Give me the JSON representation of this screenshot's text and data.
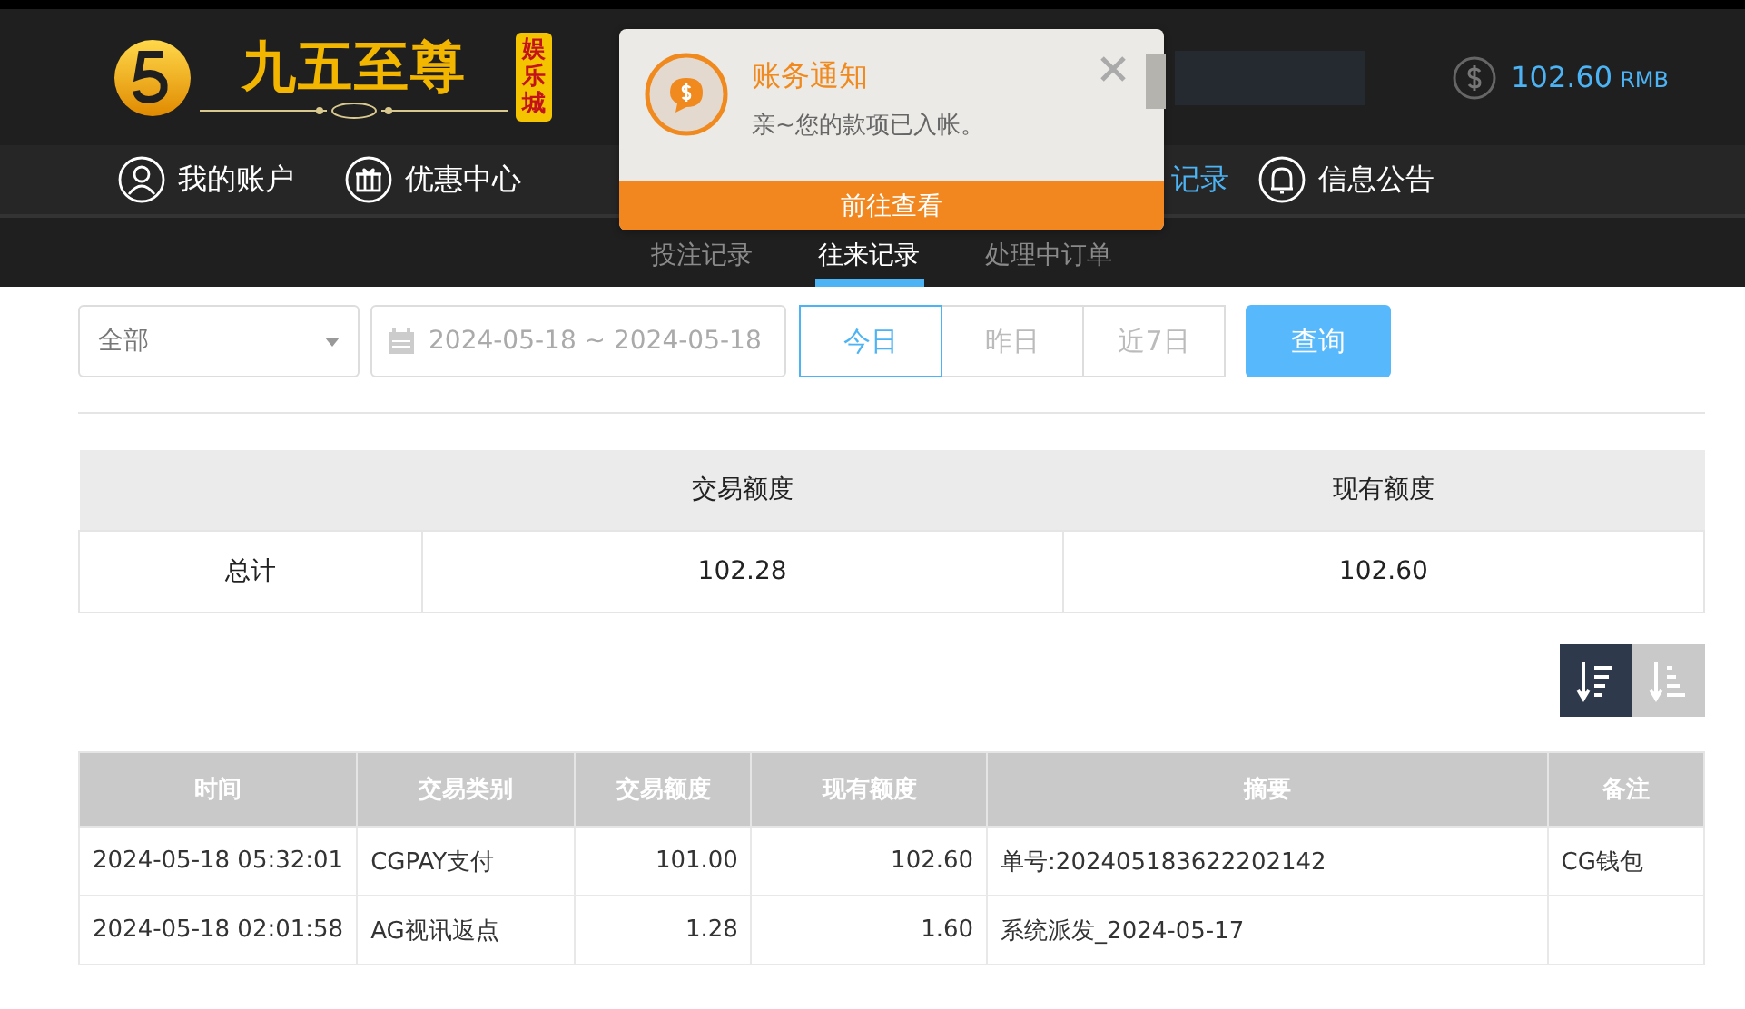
{
  "header": {
    "logo_text": "九五至尊",
    "logo_badge": "娱乐城",
    "balance": "102.60",
    "currency": "RMB"
  },
  "nav": [
    {
      "kind": "link",
      "label": "我的账户",
      "selected": false
    },
    {
      "kind": "link",
      "label": "优惠中心",
      "selected": false
    },
    {
      "kind": "covered"
    },
    {
      "kind": "covered"
    },
    {
      "kind": "partial",
      "label": "记录",
      "selected": true
    },
    {
      "kind": "link",
      "label": "信息公告",
      "selected": false
    }
  ],
  "subtabs": [
    {
      "label": "投注记录",
      "selected": false
    },
    {
      "label": "往来记录",
      "selected": true
    },
    {
      "label": "处理中订单",
      "selected": false
    }
  ],
  "filter": {
    "type_select": "全部",
    "date_range": "2024-05-18 ~ 2024-05-18",
    "search_button": "查询",
    "quick_ranges": [
      {
        "label": "今日",
        "selected": true
      },
      {
        "label": "昨日",
        "selected": false
      },
      {
        "label": "近7日",
        "selected": false
      }
    ]
  },
  "summary": {
    "columns": [
      "交易额度",
      "现有额度"
    ],
    "rows": [
      {
        "label": "总计",
        "values": [
          "102.28",
          "102.60"
        ]
      }
    ]
  },
  "sort_buttons": [
    {
      "kind": "descending",
      "selected": true
    },
    {
      "kind": "ascending",
      "selected": false
    }
  ],
  "table": {
    "columns": [
      "时间",
      "交易类别",
      "交易额度",
      "现有额度",
      "摘要",
      "备注"
    ],
    "rows": [
      [
        "2024-05-18 05:32:01",
        "CGPAY支付",
        "101.00",
        "102.60",
        "单号:202405183622202142",
        "CG钱包"
      ],
      [
        "2024-05-18 02:01:58",
        "AG视讯返点",
        "1.28",
        "1.60",
        "系统派发_2024-05-17",
        ""
      ]
    ]
  },
  "notification": {
    "title": "账务通知",
    "message": "亲~您的款项已入帐。",
    "button": "前往查看"
  }
}
